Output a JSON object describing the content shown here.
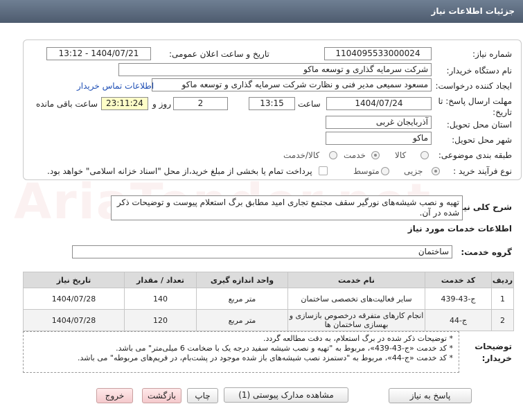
{
  "header": {
    "title": "جزئیات اطلاعات نیاز"
  },
  "watermark": {
    "text": "AriaTender.net"
  },
  "form": {
    "need_number_label": "شماره نیاز:",
    "need_number": "1104095533000024",
    "announce_label": "تاریخ و ساعت اعلان عمومی:",
    "announce_value": "1404/07/21 - 13:12",
    "buyer_label": "نام دستگاه خریدار:",
    "buyer_value": "شرکت سرمایه گذاری و توسعه ماکو",
    "creator_label": "ایجاد کننده درخواست:",
    "creator_value": "مسعود سمیعی مدیر فنی و نظارت   شرکت سرمایه گذاری و توسعه ماکو",
    "contact_link": "اطلاعات تماس خریدار",
    "deadline_label": "مهلت ارسال پاسخ: تا",
    "deadline_label2": "تاریخ:",
    "deadline_date": "1404/07/24",
    "time_label": "ساعت",
    "deadline_time": "13:15",
    "days_value": "2",
    "days_label": "روز و",
    "remaining_time": "23:11:24",
    "remaining_label": "ساعت باقی مانده",
    "province_label": "استان محل تحویل:",
    "province_value": "آذربایجان غربی",
    "city_label": "شهر محل تحویل:",
    "city_value": "ماکو",
    "category_label": "طبقه بندی موضوعی:",
    "category_options": [
      "کالا",
      "خدمت",
      "کالا/خدمت"
    ],
    "category_selected": "خدمت",
    "process_label": "نوع فرآیند خرید :",
    "process_options": [
      "جزیی",
      "متوسط"
    ],
    "payment_note": "پرداخت تمام یا بخشی از مبلغ خرید،از محل \"اسناد خزانه اسلامی\" خواهد بود."
  },
  "description": {
    "label": "شرح کلی نیاز:",
    "text": "تهیه و نصب شیشه‌های نورگیر سقف مجتمع تجاری امید مطابق برگ استعلام پیوست و توضیحات ذکر شده در آن."
  },
  "services": {
    "section_title": "اطلاعات خدمات مورد نیاز",
    "group_label": "گروه خدمت:",
    "group_value": "ساختمان",
    "columns": [
      "ردیف",
      "کد خدمت",
      "نام خدمت",
      "واحد اندازه گیری",
      "تعداد / مقدار",
      "تاریخ نیاز"
    ],
    "rows": [
      {
        "row": "1",
        "code": "ج-43-439",
        "name": "سایر فعالیت‌های تخصصی ساختمان",
        "unit": "متر مربع",
        "qty": "140",
        "date": "1404/07/28"
      },
      {
        "row": "2",
        "code": "ج-44",
        "name": "انجام کارهای متفرقه درخصوص بازسازی و بهسازی ساختمان ها",
        "unit": "متر مربع",
        "qty": "120",
        "date": "1404/07/28"
      }
    ]
  },
  "buyer_notes": {
    "label": "توضیحات خریدار:",
    "lines": [
      "* توضیحات ذکر شده در برگ استعلام، به دقت مطالعه گردد.",
      "* کد خدمت «ج-43-439»، مربوط به \"تهیه و نصب شیشه سفید درجه یک با ضخامت 6 میلی‌متر\" می باشد.",
      "* کد خدمت «ج-44»، مربوط به \"دستمزد نصب شیشه‌های باز شده موجود در پشت‌بام، در فریم‌های مربوطه\" می باشد."
    ]
  },
  "buttons": {
    "reply": "پاسخ به نیاز",
    "attachments": "مشاهده مدارک پیوستی (1)",
    "print": "چاپ",
    "back": "بازگشت",
    "exit": "خروج"
  }
}
